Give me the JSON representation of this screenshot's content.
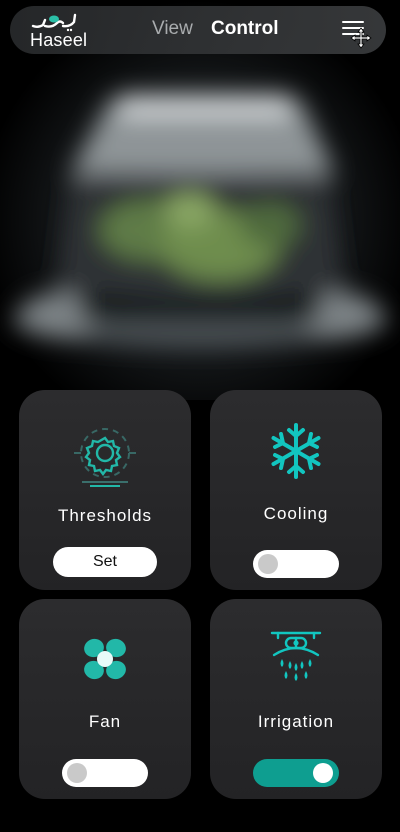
{
  "header": {
    "logo_text": "Haseel",
    "logo_arabic": "حصيل",
    "nav": {
      "view": "View",
      "control": "Control"
    },
    "active_tab": "Control"
  },
  "colors": {
    "accent": "#12c6c0",
    "toggle_on": "#0e9e90",
    "card_bg": "#2a2a2c",
    "page_bg": "#000000"
  },
  "cards": [
    {
      "title": "Thresholds",
      "icon": "gear-threshold-icon",
      "control": "button",
      "button_label": "Set"
    },
    {
      "title": "Cooling",
      "icon": "snowflake-icon",
      "control": "toggle",
      "state": "off"
    },
    {
      "title": "Fan",
      "icon": "fan-icon",
      "control": "toggle",
      "state": "off"
    },
    {
      "title": "Irrigation",
      "icon": "sprinkler-icon",
      "control": "toggle",
      "state": "on"
    }
  ]
}
